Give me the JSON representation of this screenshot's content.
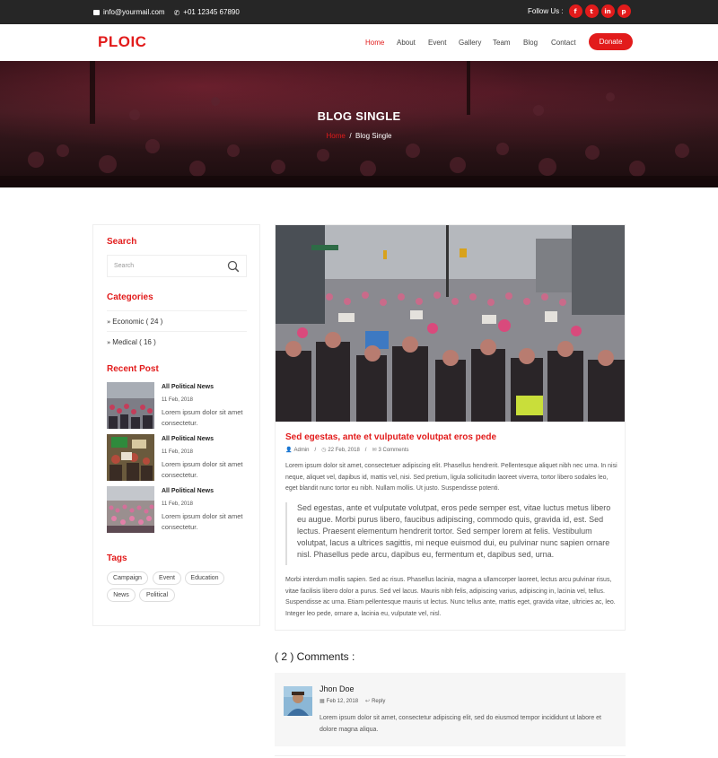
{
  "topbar": {
    "email": "info@yourmail.com",
    "phone": "+01 12345 67890",
    "follow_label": "Follow Us :",
    "social": [
      "f",
      "t",
      "in",
      "p"
    ]
  },
  "header": {
    "logo": "PLOIC",
    "nav": [
      "Home",
      "About",
      "Event",
      "Gallery",
      "Team",
      "Blog",
      "Contact"
    ],
    "active_nav": "Home",
    "donate": "Donate"
  },
  "banner": {
    "title": "BLOG SINGLE",
    "crumb_home": "Home",
    "crumb_sep": "/",
    "crumb_current": "Blog Single"
  },
  "sidebar": {
    "search_heading": "Search",
    "search_placeholder": "Search",
    "categories_heading": "Categories",
    "categories": [
      {
        "label": "Economic ( 24 )"
      },
      {
        "label": "Medical ( 16 )"
      }
    ],
    "recent_heading": "Recent Post",
    "posts": [
      {
        "title": "All Political News",
        "date": "11 Feb, 2018",
        "excerpt": "Lorem ipsum dolor sit amet consectetur."
      },
      {
        "title": "All Political News",
        "date": "11 Feb, 2018",
        "excerpt": "Lorem ipsum dolor sit amet consectetur."
      },
      {
        "title": "All Political News",
        "date": "11 Feb, 2018",
        "excerpt": "Lorem ipsum dolor sit amet consectetur."
      }
    ],
    "tags_heading": "Tags",
    "tags": [
      "Campaign",
      "Event",
      "Education",
      "News",
      "Political"
    ]
  },
  "article": {
    "title": "Sed egestas, ante et vulputate volutpat eros pede",
    "author": "Admin",
    "date": "22 Feb, 2018",
    "comments": "3 Comments",
    "para1": "Lorem ipsum dolor sit amet, consectetuer adipiscing elit. Phasellus hendrerit. Pellentesque aliquet nibh nec urna. In nisi neque, aliquet vel, dapibus id, mattis vel, nisi. Sed pretium, ligula sollicitudin laoreet viverra, tortor libero sodales leo, eget blandit nunc tortor eu nibh. Nullam mollis. Ut justo. Suspendisse potenti.",
    "quote": "Sed egestas, ante et vulputate volutpat, eros pede semper est, vitae luctus metus libero eu augue. Morbi purus libero, faucibus adipiscing, commodo quis, gravida id, est. Sed lectus. Praesent elementum hendrerit tortor. Sed semper lorem at felis. Vestibulum volutpat, lacus a ultrices sagittis, mi neque euismod dui, eu pulvinar nunc sapien ornare nisl. Phasellus pede arcu, dapibus eu, fermentum et, dapibus sed, urna.",
    "para2": "Morbi interdum mollis sapien. Sed ac risus. Phasellus lacinia, magna a ullamcorper laoreet, lectus arcu pulvinar risus, vitae facilisis libero dolor a purus. Sed vel lacus. Mauris nibh felis, adipiscing varius, adipiscing in, lacinia vel, tellus. Suspendisse ac urna. Etiam pellentesque mauris ut lectus. Nunc tellus ante, mattis eget, gravida vitae, ultricies ac, leo. Integer leo pede, ornare a, lacinia eu, vulputate vel, nisl."
  },
  "comments": {
    "heading": "( 2 ) Comments :",
    "items": [
      {
        "name": "Jhon Doe",
        "date": "Feb 12, 2018",
        "reply": "Reply",
        "text": "Lorem ipsum dolor sit amet, consectetur adipiscing elit, sed do eiusmod tempor incididunt ut labore et dolore magna aliqua."
      }
    ]
  },
  "colors": {
    "accent": "#e21b1b",
    "topbar": "#262626"
  }
}
